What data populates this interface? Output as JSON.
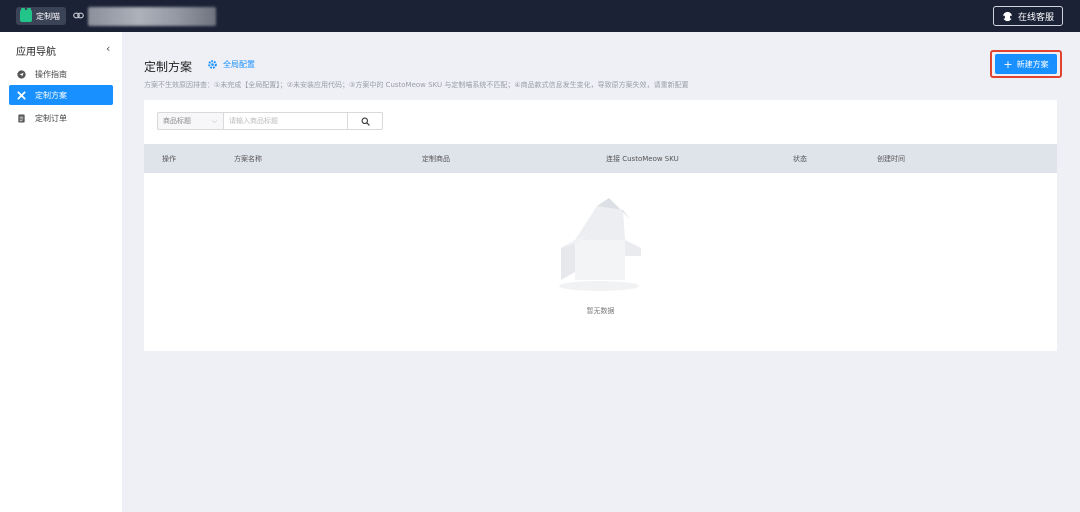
{
  "topbar": {
    "app_name": "定制喵",
    "customer_service_label": "在线客服"
  },
  "sidebar": {
    "title": "应用导航",
    "collapse_icon": "chevron-left-icon",
    "items": [
      {
        "label": "操作指南",
        "icon": "paper-plane-icon",
        "active": false
      },
      {
        "label": "定制方案",
        "icon": "tools-icon",
        "active": true
      },
      {
        "label": "定制订单",
        "icon": "document-icon",
        "active": false
      }
    ]
  },
  "main": {
    "title": "定制方案",
    "global_config_label": "全局配置",
    "hint": "方案不生效原因排查：①未完成【全局配置】；②未安装应用代码；③方案中的 CustoMeow SKU 与定制喵系统不匹配；④商品款式信息发生变化，导致原方案失效，请重新配置",
    "new_button_label": "新建方案",
    "accent_color": "#1890ff",
    "highlight_color": "#e0432f"
  },
  "table": {
    "filter_select_value": "商品标题",
    "search_placeholder": "请输入商品标题",
    "columns": [
      "操作",
      "方案名称",
      "定制商品",
      "连接 CustoMeow SKU",
      "状态",
      "创建时间"
    ],
    "rows": [],
    "empty_text": "暂无数据"
  }
}
